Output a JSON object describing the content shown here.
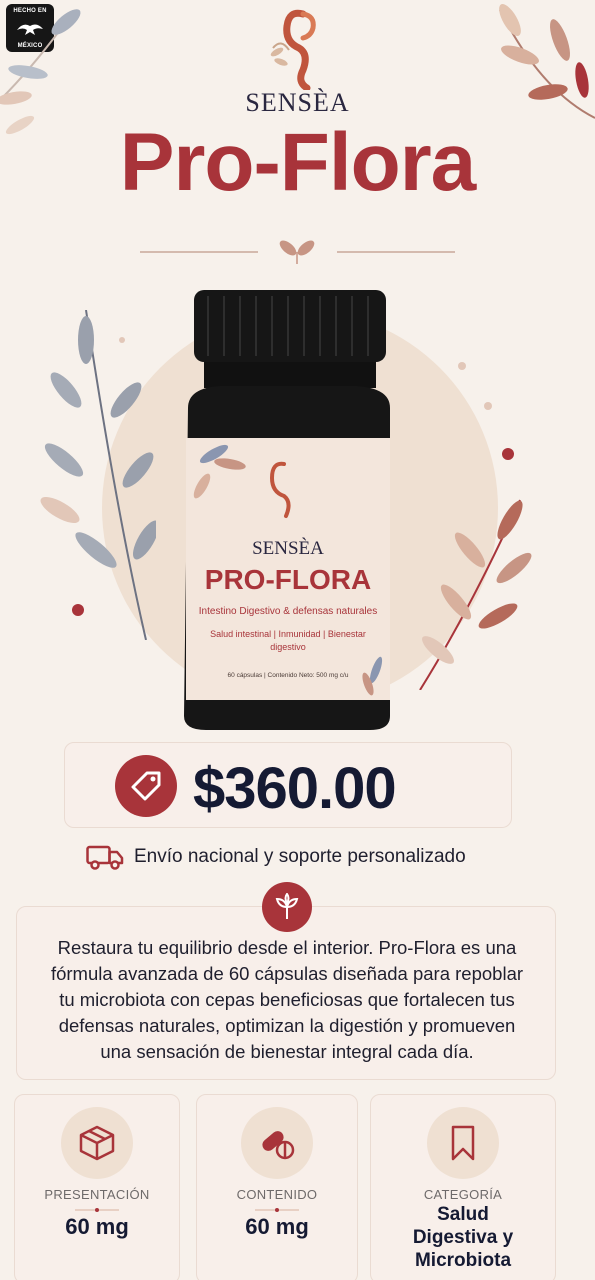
{
  "badge": {
    "line1": "HECHO EN",
    "line2": "MÉXICO"
  },
  "brand": {
    "name": "SENSÈA"
  },
  "product": {
    "title": "Pro-Flora",
    "label_brand": "SENSÈA",
    "label_title": "PRO-FLORA",
    "label_subtitle": "Intestino Digestivo & defensas naturales",
    "label_benefits": "Salud intestinal | Inmunidad | Bienestar digestivo",
    "label_content": "60 cápsulas | Contenido Neto: 500 mg c/u"
  },
  "price": {
    "value": "$360.00"
  },
  "shipping": {
    "text": "Envío nacional y soporte personalizado"
  },
  "description": {
    "text": "Restaura tu equilibrio desde el interior. Pro-Flora es una fórmula avanzada de 60 cápsulas diseñada para repoblar tu microbiota con cepas beneficiosas que fortalecen tus defensas naturales, optimizan la digestión y promueven una sensación de bienestar integral cada día."
  },
  "specs": [
    {
      "label": "PRESENTACIÓN",
      "value": "60 mg",
      "icon": "box-icon"
    },
    {
      "label": "CONTENIDO",
      "value": "60 mg",
      "icon": "capsule-icon"
    },
    {
      "label": "CATEGORÍA",
      "value": "Salud Digestiva y Microbiota",
      "icon": "bookmark-icon"
    }
  ],
  "colors": {
    "accent": "#a8343a",
    "background": "#f7f1eb",
    "dark": "#151a33"
  }
}
